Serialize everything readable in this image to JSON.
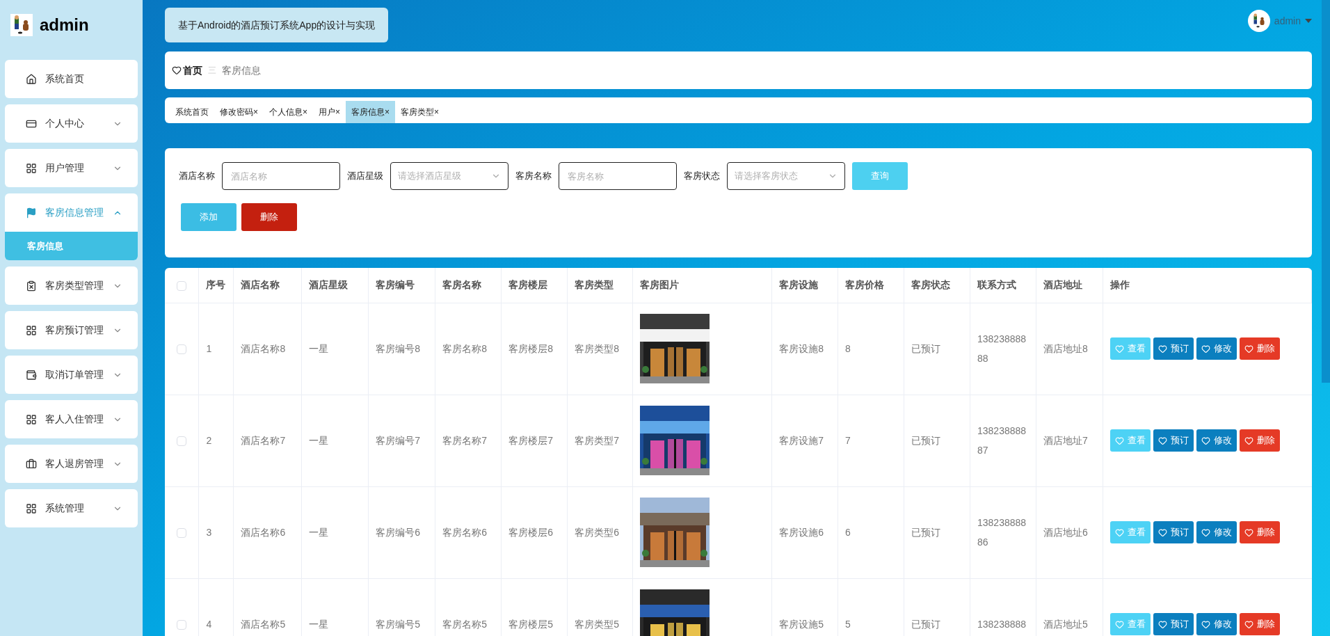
{
  "sidebar": {
    "logo_text": "admin",
    "items": [
      {
        "label": "系统首页",
        "kind": "link",
        "expanded": false
      },
      {
        "label": "个人中心",
        "kind": "group",
        "expanded": false
      },
      {
        "label": "用户管理",
        "kind": "group",
        "expanded": false
      },
      {
        "label": "客房信息管理",
        "kind": "group",
        "expanded": true,
        "children": [
          {
            "label": "客房信息",
            "selected": true
          }
        ]
      },
      {
        "label": "客房类型管理",
        "kind": "group",
        "expanded": false
      },
      {
        "label": "客房预订管理",
        "kind": "group",
        "expanded": false
      },
      {
        "label": "取消订单管理",
        "kind": "group",
        "expanded": false
      },
      {
        "label": "客人入住管理",
        "kind": "group",
        "expanded": false
      },
      {
        "label": "客人退房管理",
        "kind": "group",
        "expanded": false
      },
      {
        "label": "系统管理",
        "kind": "group",
        "expanded": false
      }
    ]
  },
  "header": {
    "title": "基于Android的酒店预订系统App的设计与实现",
    "user": "admin"
  },
  "breadcrumb": {
    "home": "首页",
    "separator": "三",
    "current": "客房信息"
  },
  "tabs": [
    {
      "label": "系统首页",
      "selected": false
    },
    {
      "label": "修改密码",
      "close": "×",
      "selected": false
    },
    {
      "label": "个人信息",
      "close": "×",
      "selected": false
    },
    {
      "label": "用户",
      "close": "×",
      "selected": false
    },
    {
      "label": "客房信息",
      "close": "×",
      "selected": true
    },
    {
      "label": "客房类型",
      "close": "×",
      "selected": false
    }
  ],
  "search": {
    "fields": [
      {
        "label": "酒店名称",
        "kind": "input",
        "placeholder": "酒店名称"
      },
      {
        "label": "酒店星级",
        "kind": "select",
        "placeholder": "请选择酒店星级"
      },
      {
        "label": "客房名称",
        "kind": "input",
        "placeholder": "客房名称"
      },
      {
        "label": "客房状态",
        "kind": "select",
        "placeholder": "请选择客房状态"
      }
    ],
    "query_button": "查询",
    "add_button": "添加",
    "delete_button": "删除"
  },
  "table": {
    "columns": [
      "序号",
      "酒店名称",
      "酒店星级",
      "客房编号",
      "客房名称",
      "客房楼层",
      "客房类型",
      "客房图片",
      "客房设施",
      "客房价格",
      "客房状态",
      "联系方式",
      "酒店地址",
      "操作"
    ],
    "header_checked": false,
    "rows": [
      {
        "checked": false,
        "cells": [
          "1",
          "酒店名称8",
          "一星",
          "客房编号8",
          "客房名称8",
          "客房楼层8",
          "客房类型8",
          null,
          "客房设施8",
          "8",
          "已预订",
          "13823888888",
          "酒店地址8"
        ],
        "actions": [
          "查看",
          "预订",
          "修改",
          "删除"
        ]
      },
      {
        "checked": false,
        "cells": [
          "2",
          "酒店名称7",
          "一星",
          "客房编号7",
          "客房名称7",
          "客房楼层7",
          "客房类型7",
          null,
          "客房设施7",
          "7",
          "已预订",
          "13823888887",
          "酒店地址7"
        ],
        "actions": [
          "查看",
          "预订",
          "修改",
          "删除"
        ]
      },
      {
        "checked": false,
        "cells": [
          "3",
          "酒店名称6",
          "一星",
          "客房编号6",
          "客房名称6",
          "客房楼层6",
          "客房类型6",
          null,
          "客房设施6",
          "6",
          "已预订",
          "13823888886",
          "酒店地址6"
        ],
        "actions": [
          "查看",
          "预订",
          "修改",
          "删除"
        ]
      },
      {
        "checked": false,
        "cells": [
          "4",
          "酒店名称5",
          "一星",
          "客房编号5",
          "客房名称5",
          "客房楼层5",
          "客房类型5",
          null,
          "客房设施5",
          "5",
          "已预订",
          "138238888",
          "酒店地址5"
        ],
        "actions": [
          "查看",
          "预订",
          "修改",
          "删除"
        ]
      }
    ]
  }
}
